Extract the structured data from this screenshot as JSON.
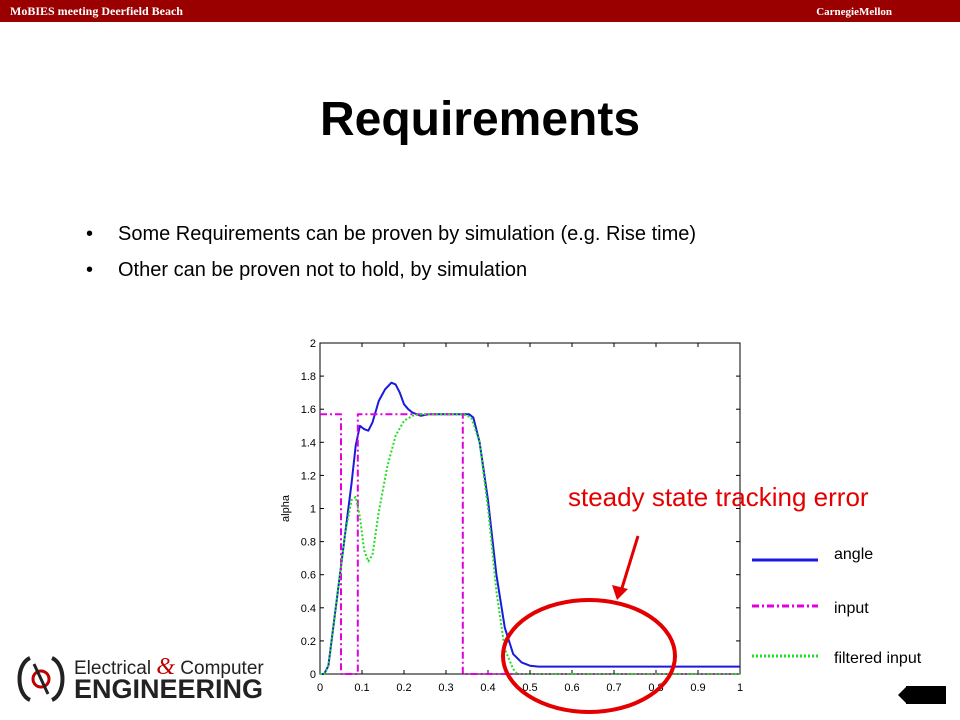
{
  "header": {
    "left_text": "MoBIES meeting Deerfield Beach",
    "right_text": "CarnegieMellon"
  },
  "slide": {
    "title": "Requirements",
    "bullets": [
      "Some Requirements can be proven by simulation (e.g. Rise time)",
      "Other can be proven not to hold, by simulation"
    ],
    "annotation": "steady state tracking error",
    "annotation_color": "#e40000"
  },
  "logo": {
    "line1_a": "Electrical ",
    "amp": "&",
    "line1_b": " Computer",
    "line2": "ENGINEERING"
  },
  "chart_data": {
    "type": "line",
    "ylabel": "alpha",
    "xlim": [
      0,
      1
    ],
    "ylim": [
      0,
      2
    ],
    "xticks": [
      "0",
      "0.1",
      "0.2",
      "0.3",
      "0.4",
      "0.5",
      "0.6",
      "0.7",
      "0.8",
      "0.9",
      "1"
    ],
    "yticks": [
      "0",
      "0.2",
      "0.4",
      "0.6",
      "0.8",
      "1",
      "1.2",
      "1.4",
      "1.6",
      "1.8",
      "2"
    ],
    "legend": "right",
    "series": [
      {
        "name": "angle",
        "color": "#1a1adf",
        "style": "solid",
        "x": [
          0,
          0.01,
          0.02,
          0.04,
          0.06,
          0.075,
          0.085,
          0.095,
          0.105,
          0.115,
          0.125,
          0.14,
          0.155,
          0.17,
          0.18,
          0.19,
          0.2,
          0.21,
          0.22,
          0.24,
          0.26,
          0.3,
          0.34,
          0.355,
          0.365,
          0.38,
          0.4,
          0.42,
          0.44,
          0.46,
          0.48,
          0.5,
          0.52,
          0.55,
          0.6,
          0.7,
          0.8,
          0.9,
          1.0
        ],
        "y": [
          0,
          0,
          0.05,
          0.45,
          0.85,
          1.15,
          1.38,
          1.5,
          1.48,
          1.47,
          1.52,
          1.65,
          1.72,
          1.76,
          1.75,
          1.7,
          1.63,
          1.6,
          1.58,
          1.56,
          1.57,
          1.57,
          1.57,
          1.57,
          1.55,
          1.4,
          1.05,
          0.6,
          0.28,
          0.12,
          0.07,
          0.05,
          0.045,
          0.045,
          0.045,
          0.045,
          0.045,
          0.045,
          0.045
        ]
      },
      {
        "name": "input",
        "color": "#e000e0",
        "style": "dashdot",
        "x": [
          0,
          0.05,
          0.05,
          0.09,
          0.09,
          0.34,
          0.34,
          1.0
        ],
        "y": [
          1.57,
          1.57,
          0,
          0,
          1.57,
          1.57,
          0,
          0
        ]
      },
      {
        "name": "filtered input",
        "color": "#22dd22",
        "style": "dotted",
        "x": [
          0,
          0.01,
          0.02,
          0.04,
          0.06,
          0.075,
          0.085,
          0.095,
          0.105,
          0.115,
          0.125,
          0.14,
          0.16,
          0.18,
          0.2,
          0.22,
          0.24,
          0.26,
          0.3,
          0.34,
          0.36,
          0.38,
          0.4,
          0.42,
          0.44,
          0.46,
          0.47,
          0.5,
          0.6,
          0.8,
          1.0
        ],
        "y": [
          0,
          0,
          0.05,
          0.45,
          0.85,
          1.05,
          1.07,
          0.95,
          0.75,
          0.68,
          0.72,
          0.98,
          1.25,
          1.44,
          1.53,
          1.56,
          1.57,
          1.57,
          1.57,
          1.57,
          1.55,
          1.4,
          1.0,
          0.5,
          0.15,
          0.03,
          0.0,
          0,
          0,
          0,
          0
        ]
      }
    ]
  }
}
